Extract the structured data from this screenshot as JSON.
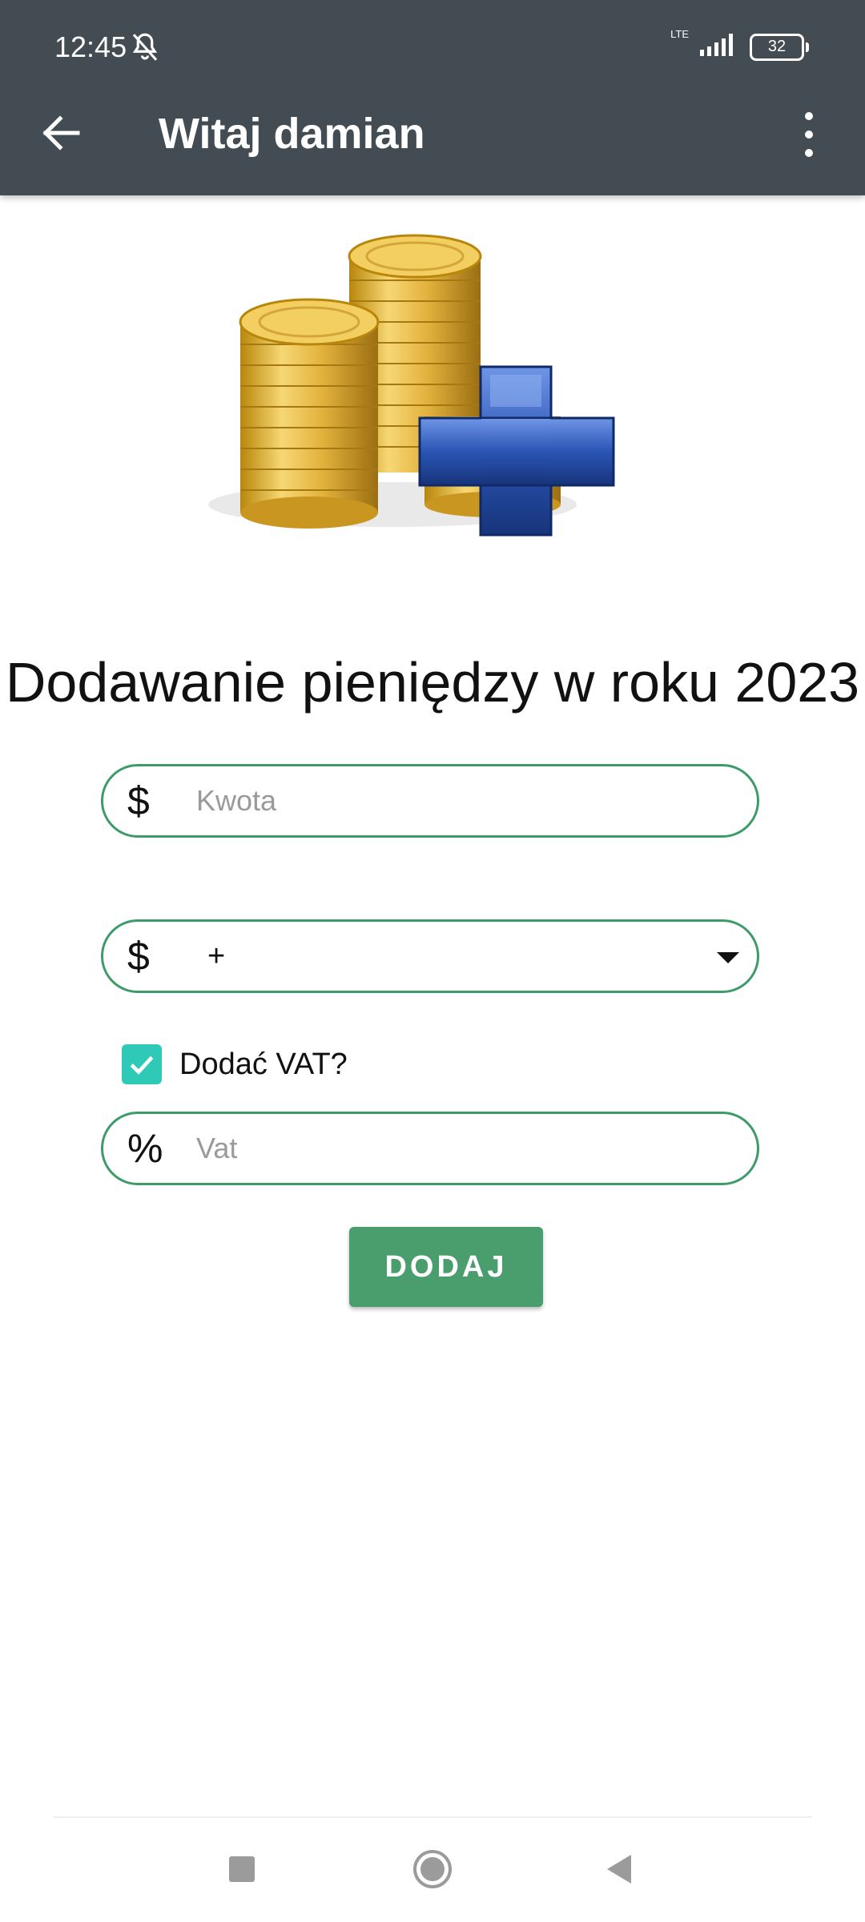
{
  "status_bar": {
    "time": "12:45",
    "network": "LTE",
    "battery": "32",
    "icons": [
      "bell-off-icon",
      "signal-icon",
      "battery-icon"
    ]
  },
  "app_bar": {
    "title": "Witaj damian",
    "back_icon": "arrow-back-icon",
    "menu_icon": "more-vertical-icon"
  },
  "illustration": {
    "icon": "coins-plus-illustration"
  },
  "main": {
    "heading": "Dodawanie pieniędzy w roku 2023",
    "amount_field": {
      "prefix": "$",
      "placeholder": "Kwota"
    },
    "operation_select": {
      "prefix": "$",
      "selected": "+"
    },
    "vat_checkbox": {
      "label": "Dodać VAT?",
      "checked": true
    },
    "vat_field": {
      "prefix": "%",
      "placeholder": "Vat"
    },
    "submit_label": "DODAJ"
  },
  "nav_bar": {
    "icons": [
      "recents-icon",
      "home-icon",
      "back-triangle-icon"
    ]
  },
  "colors": {
    "app_bar": "#424c52",
    "accent": "#4a9e6d",
    "field_border": "#3d9b6a",
    "checkbox": "#2fc9b8"
  }
}
